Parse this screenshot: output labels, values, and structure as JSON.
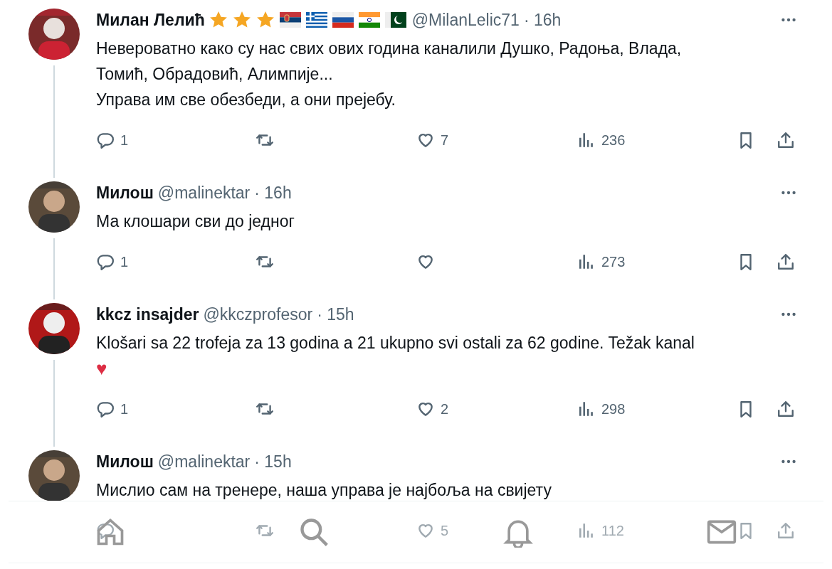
{
  "tweets": [
    {
      "name": "Милан Лелић",
      "badges": [
        {
          "kind": "star"
        },
        {
          "kind": "star"
        },
        {
          "kind": "star"
        },
        {
          "kind": "serbia"
        },
        {
          "kind": "greece"
        },
        {
          "kind": "russia"
        },
        {
          "kind": "india"
        },
        {
          "kind": "pakistan"
        }
      ],
      "handle": "@MilanLelic71",
      "time": "· 16h",
      "text": "Невероватно како су нас свих ових година каналили Душко, Радоња, Влада,\nТомић, Обрадовић, Алимпије...\nУправа им све обезбеди, а они прејебу.",
      "thread_line": true,
      "replies": "1",
      "likes": "7",
      "views": "236"
    },
    {
      "name": "Милош",
      "handle": "@malinektar",
      "time": "· 16h",
      "text": "Ма клошари сви до једног",
      "thread_line": true,
      "replies": "1",
      "views": "273"
    },
    {
      "name": "kkcz insajder",
      "handle": "@kkczprofesor",
      "time": "· 15h",
      "text": "Klošari sa 22 trofeja za 13 godina a 21 ukupno svi ostali za 62 godine. Težak kanal",
      "emoji": "♥",
      "thread_line": true,
      "replies": "1",
      "likes": "2",
      "views": "298"
    },
    {
      "name": "Милош",
      "handle": "@malinektar",
      "time": "· 15h",
      "text": "Мислио сам на тренере, наша управа је најбоља на свијету",
      "thread_line": false,
      "likes": "5",
      "views": "112"
    }
  ],
  "nav": [
    {
      "kind": "home"
    },
    {
      "kind": "search"
    },
    {
      "kind": "bell"
    },
    {
      "kind": "mail"
    }
  ]
}
